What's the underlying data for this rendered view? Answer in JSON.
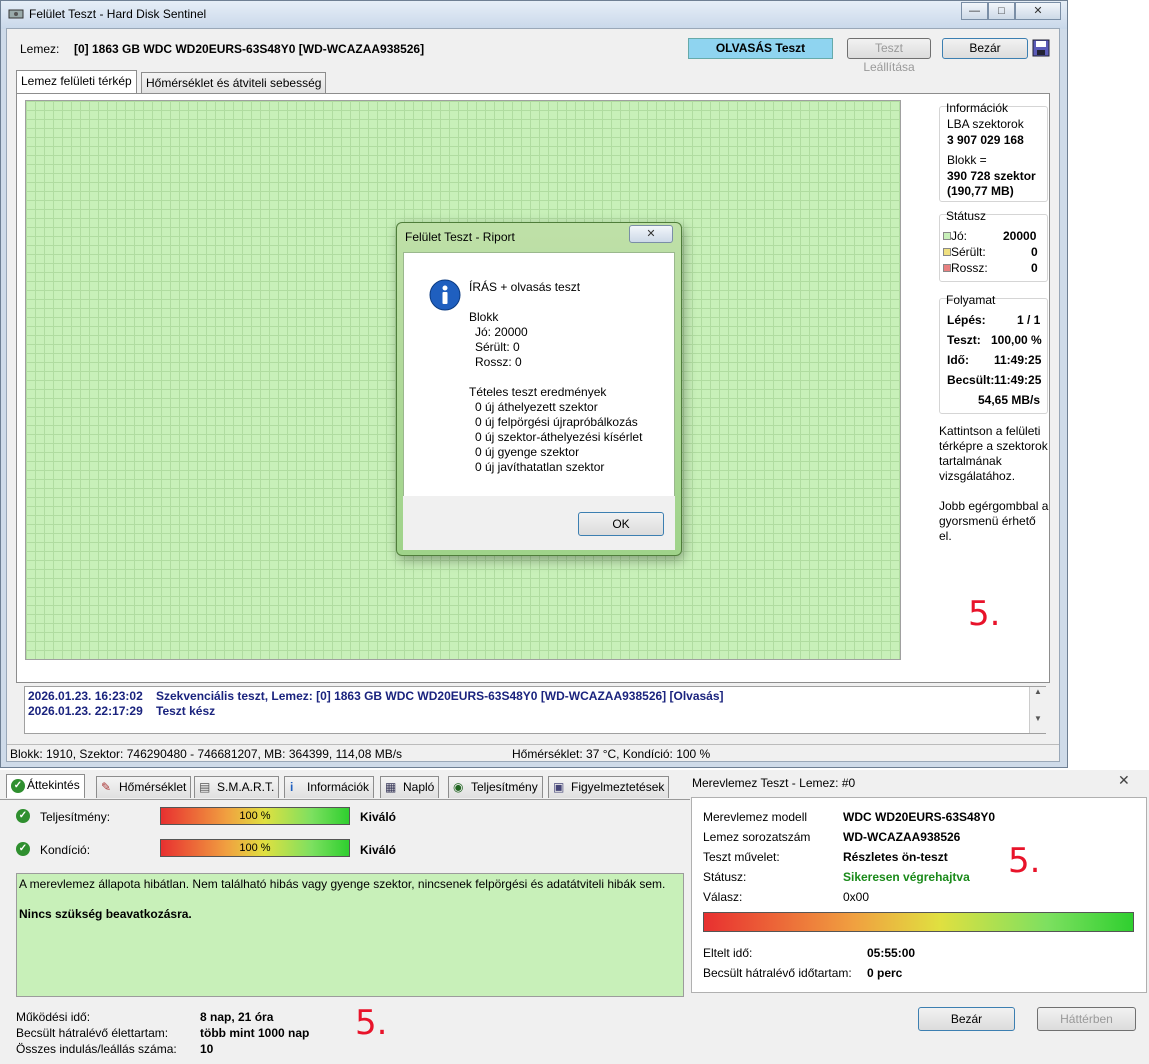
{
  "main_window": {
    "title": "Felület Teszt - Hard Disk Sentinel",
    "minimize_label": "—",
    "maximize_label": "□",
    "close_label": "✕",
    "disk_label": "Lemez:",
    "disk_value": "[0] 1863 GB  WDC WD20EURS-63S48Y0 [WD-WCAZAA938526]",
    "mode_badge": "OLVASÁS Teszt",
    "stop_button": "Teszt Leállítása",
    "close_button": "Bezár",
    "tabs": [
      "Lemez felületi térkép",
      "Hőmérséklet és átviteli sebesség"
    ],
    "info": {
      "title": "Információk",
      "lba_label": "LBA szektorok",
      "lba_value": "3 907 029 168",
      "block_label": "Blokk =",
      "block_value": "390 728 szektor",
      "block_mb": "(190,77 MB)"
    },
    "status": {
      "title": "Státusz",
      "good_label": "Jó:",
      "good_value": "20000",
      "damaged_label": "Sérült:",
      "damaged_value": "0",
      "bad_label": "Rossz:",
      "bad_value": "0"
    },
    "progress": {
      "title": "Folyamat",
      "step_label": "Lépés:",
      "step_value": "1 / 1",
      "test_label": "Teszt:",
      "test_value": "100,00 %",
      "time_label": "Idő:",
      "time_value": "11:49:25",
      "est_label": "Becsült:",
      "est_value": "11:49:25",
      "speed": "54,65 MB/s"
    },
    "hint1": [
      "Kattintson a felületi",
      "térképre a szektorok",
      "tartalmának",
      "vizsgálatához."
    ],
    "hint2": [
      "Jobb egérgombbal a",
      "gyorsmenü érhető",
      "el."
    ],
    "annotation": "5.",
    "log": [
      {
        "date": "2026.01.23.  16:23:02",
        "text": "Szekvenciális teszt, Lemez: [0] 1863 GB  WDC WD20EURS-63S48Y0 [WD-WCAZAA938526] [Olvasás]"
      },
      {
        "date": "2026.01.23.  22:17:29",
        "text": "Teszt kész"
      }
    ],
    "statusbar_left": "Blokk: 1910, Szektor: 746290480 - 746681207, MB: 364399, 114,08 MB/s",
    "statusbar_right": "Hőmérséklet: 37  °C,  Kondíció: 100 %"
  },
  "dialog": {
    "title": "Felület Teszt - Riport",
    "close_label": "✕",
    "heading": "ÍRÁS + olvasás teszt",
    "block_title": "Blokk",
    "block_lines": [
      "Jó: 20000",
      "Sérült: 0",
      "Rossz: 0"
    ],
    "results_title": "Tételes teszt eredmények",
    "results_lines": [
      "0 új áthelyezett szektor",
      "0 új felpörgési újrapróbálkozás",
      "0 új szektor-áthelyezési kísérlet",
      "0 új gyenge szektor",
      "0 új javíthatatlan szektor"
    ],
    "ok_button": "OK"
  },
  "overview": {
    "tabs": [
      "Áttekintés",
      "Hőmérséklet",
      "S.M.A.R.T.",
      "Információk",
      "Napló",
      "Teljesítmény",
      "Figyelmeztetések"
    ],
    "performance_label": "Teljesítmény:",
    "performance_value": "100 %",
    "performance_rating": "Kiváló",
    "condition_label": "Kondíció:",
    "condition_value": "100 %",
    "condition_rating": "Kiváló",
    "note_text": "A merevlemez állapota hibátlan. Nem található hibás vagy gyenge szektor, nincsenek felpörgési és adatátviteli hibák sem.",
    "note_bold": "Nincs szükség beavatkozásra.",
    "uptime_label": "Működési idő:",
    "uptime_value": "8 nap, 21 óra",
    "lifetime_label": "Becsült hátralévő élettartam:",
    "lifetime_value": "több mint 1000 nap",
    "starts_label": "Összes indulás/leállás száma:",
    "starts_value": "10",
    "annotation": "5."
  },
  "selftest": {
    "title": "Merevlemez Teszt - Lemez: #0",
    "close_label": "✕",
    "model_label": "Merevlemez modell",
    "model_value": "WDC WD20EURS-63S48Y0",
    "serial_label": "Lemez sorozatszám",
    "serial_value": "WD-WCAZAA938526",
    "op_label": "Teszt művelet:",
    "op_value": "Részletes ön-teszt",
    "status_label": "Státusz:",
    "status_value": "Sikeresen végrehajtva",
    "reply_label": "Válasz:",
    "reply_value": "0x00",
    "elapsed_label": "Eltelt idő:",
    "elapsed_value": "05:55:00",
    "remaining_label": "Becsült hátralévő időtartam:",
    "remaining_value": "0 perc",
    "close_button": "Bezár",
    "background_button": "Háttérben",
    "annotation": "5."
  }
}
